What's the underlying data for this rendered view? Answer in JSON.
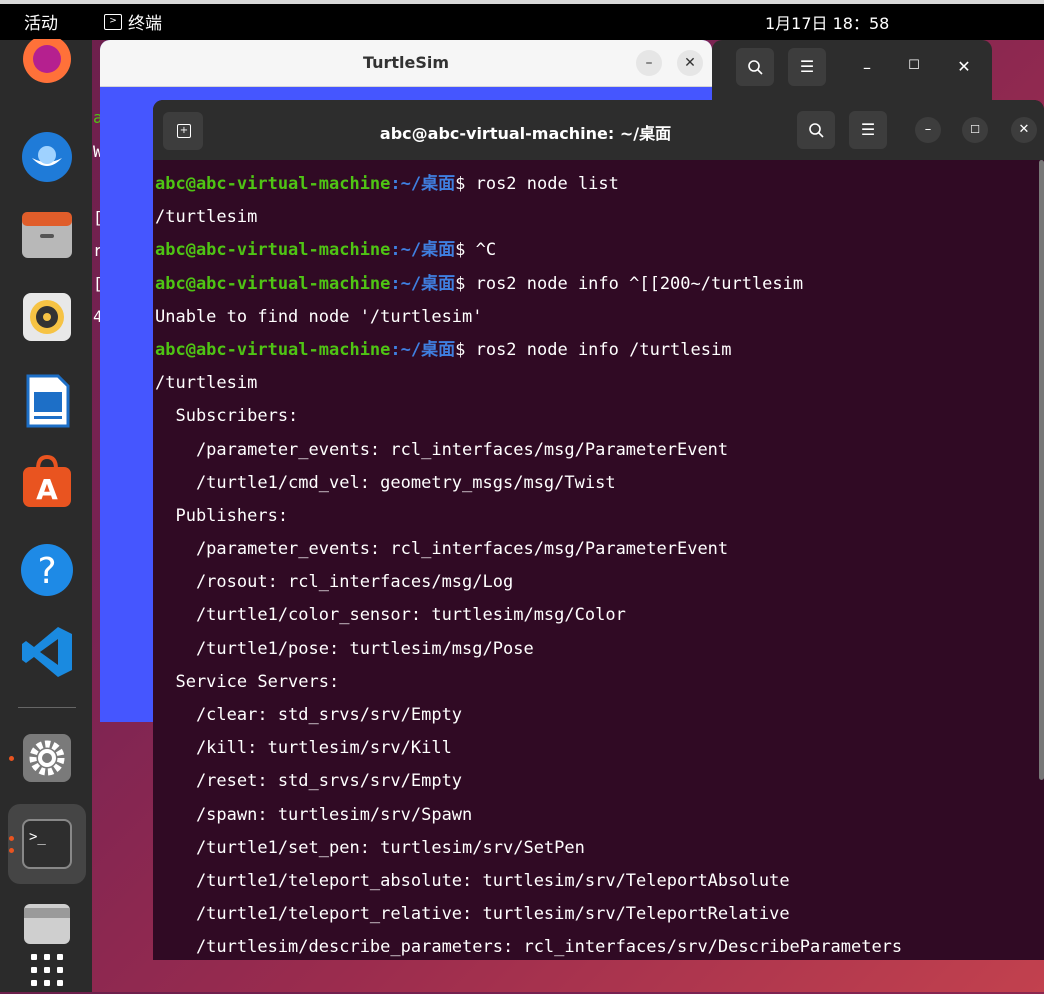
{
  "topbar": {
    "activities": "活动",
    "app_name": "终端",
    "clock": "1月17日 18：58"
  },
  "dock": {
    "items": [
      "firefox-icon",
      "thunderbird-icon",
      "files-icon",
      "rhythmbox-icon",
      "writer-icon",
      "software-icon",
      "help-icon",
      "vscode-icon",
      "settings-icon",
      "terminal-icon",
      "disk-icon",
      "apps-grid-icon"
    ]
  },
  "turtlesim": {
    "title": "TurtleSim"
  },
  "terminal": {
    "title": "abc@abc-virtual-machine: ~/桌面",
    "user_host": "abc@abc-virtual-machine",
    "path": ":~/桌面",
    "lines": [
      {
        "type": "prompt",
        "cmd": "$ ros2 node list"
      },
      {
        "type": "out",
        "text": "/turtlesim"
      },
      {
        "type": "prompt",
        "cmd": "$ ^C"
      },
      {
        "type": "prompt",
        "cmd": "$ ros2 node info ^[[200~/turtlesim"
      },
      {
        "type": "out",
        "text": "Unable to find node '/turtlesim'"
      },
      {
        "type": "prompt",
        "cmd": "$ ros2 node info /turtlesim"
      },
      {
        "type": "out",
        "text": "/turtlesim"
      },
      {
        "type": "out",
        "text": "  Subscribers:"
      },
      {
        "type": "out",
        "text": "    /parameter_events: rcl_interfaces/msg/ParameterEvent"
      },
      {
        "type": "out",
        "text": "    /turtle1/cmd_vel: geometry_msgs/msg/Twist"
      },
      {
        "type": "out",
        "text": "  Publishers:"
      },
      {
        "type": "out",
        "text": "    /parameter_events: rcl_interfaces/msg/ParameterEvent"
      },
      {
        "type": "out",
        "text": "    /rosout: rcl_interfaces/msg/Log"
      },
      {
        "type": "out",
        "text": "    /turtle1/color_sensor: turtlesim/msg/Color"
      },
      {
        "type": "out",
        "text": "    /turtle1/pose: turtlesim/msg/Pose"
      },
      {
        "type": "out",
        "text": "  Service Servers:"
      },
      {
        "type": "out",
        "text": "    /clear: std_srvs/srv/Empty"
      },
      {
        "type": "out",
        "text": "    /kill: turtlesim/srv/Kill"
      },
      {
        "type": "out",
        "text": "    /reset: std_srvs/srv/Empty"
      },
      {
        "type": "out",
        "text": "    /spawn: turtlesim/srv/Spawn"
      },
      {
        "type": "out",
        "text": "    /turtle1/set_pen: turtlesim/srv/SetPen"
      },
      {
        "type": "out",
        "text": "    /turtle1/teleport_absolute: turtlesim/srv/TeleportAbsolute"
      },
      {
        "type": "out",
        "text": "    /turtle1/teleport_relative: turtlesim/srv/TeleportRelative"
      },
      {
        "type": "out",
        "text": "    /turtlesim/describe_parameters: rcl_interfaces/srv/DescribeParameters"
      }
    ]
  },
  "hidden_terminal_sliver": [
    "a",
    "W",
    "[",
    "r",
    "[",
    "4"
  ]
}
